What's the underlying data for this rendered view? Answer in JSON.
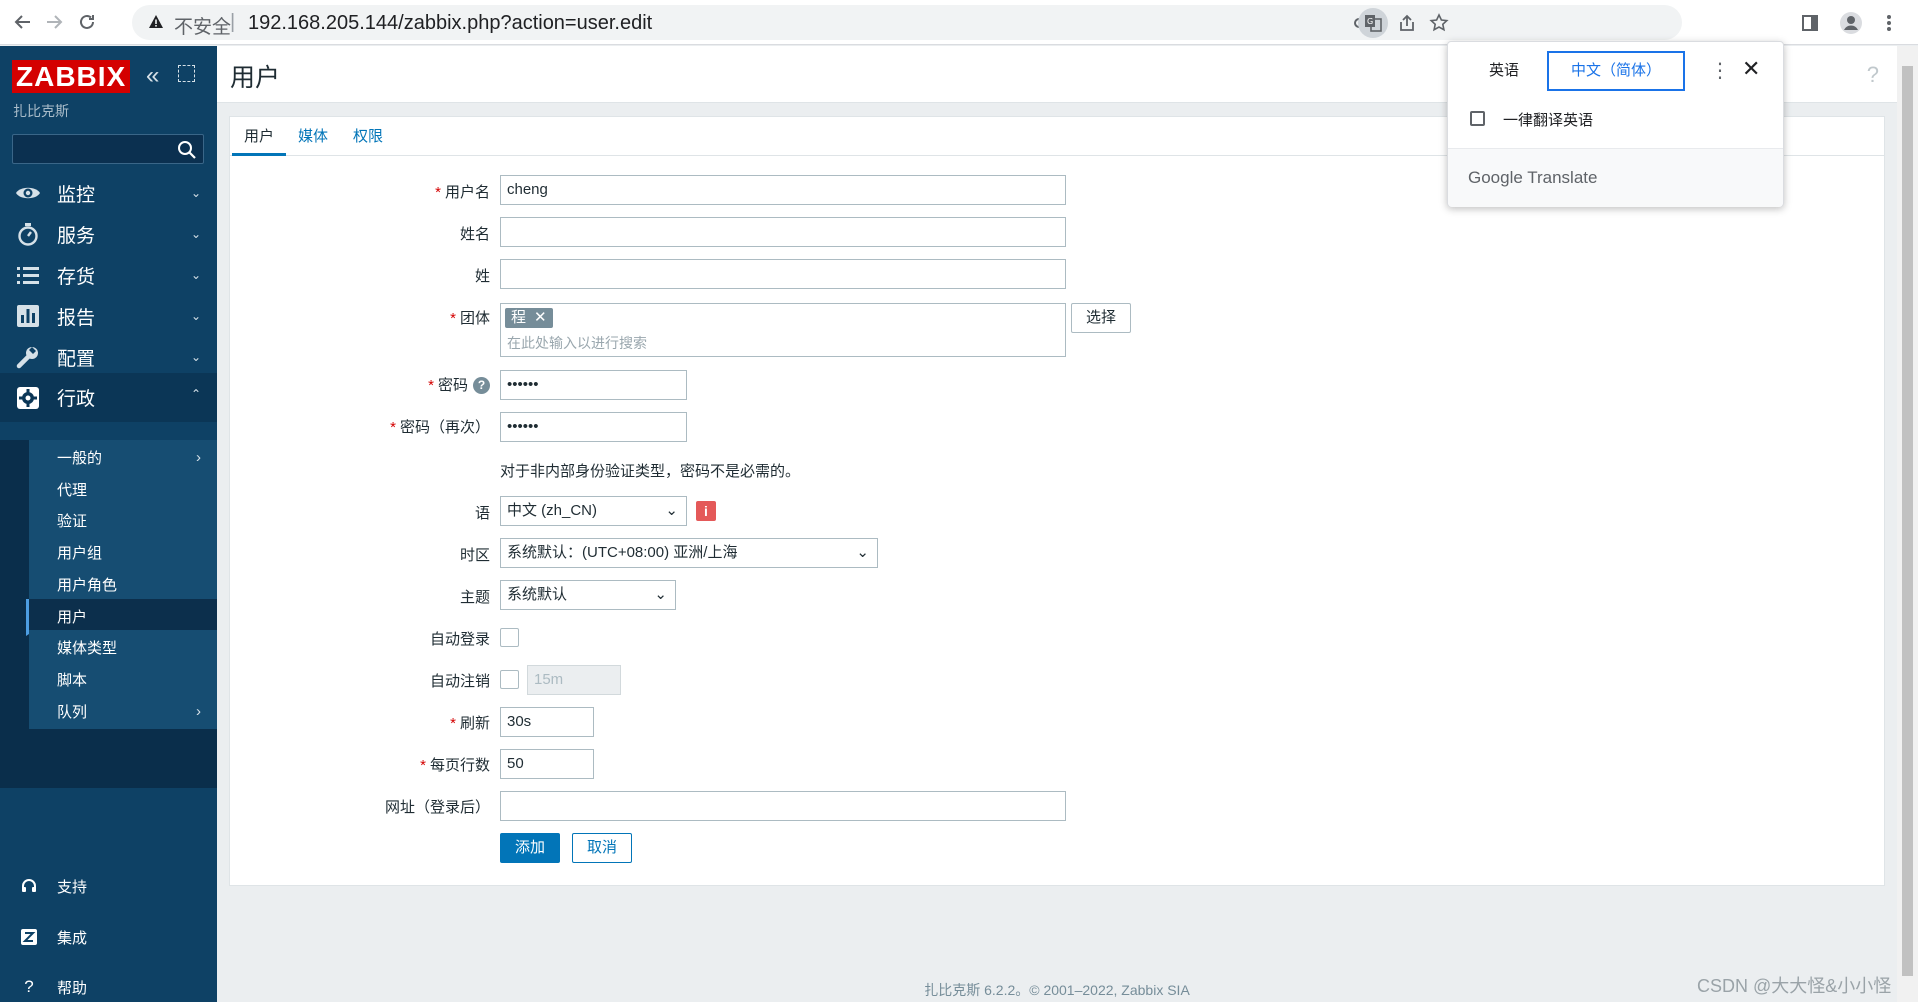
{
  "browser": {
    "security_label": "不安全",
    "url": "192.168.205.144/zabbix.php?action=user.edit"
  },
  "sidebar": {
    "logo": "ZABBIX",
    "server_name": "扎比克斯",
    "search_placeholder": "",
    "menu": [
      {
        "label": "监控"
      },
      {
        "label": "服务"
      },
      {
        "label": "存货"
      },
      {
        "label": "报告"
      },
      {
        "label": "配置"
      },
      {
        "label": "行政"
      }
    ],
    "submenu": [
      {
        "label": "一般的"
      },
      {
        "label": "代理"
      },
      {
        "label": "验证"
      },
      {
        "label": "用户组"
      },
      {
        "label": "用户角色"
      },
      {
        "label": "用户"
      },
      {
        "label": "媒体类型"
      },
      {
        "label": "脚本"
      },
      {
        "label": "队列"
      }
    ],
    "bottom": [
      {
        "label": "支持"
      },
      {
        "label": "集成"
      },
      {
        "label": "帮助"
      }
    ]
  },
  "page": {
    "title": "用户",
    "help": "?"
  },
  "tabs": [
    {
      "label": "用户"
    },
    {
      "label": "媒体"
    },
    {
      "label": "权限"
    }
  ],
  "form": {
    "username": {
      "label": "用户名",
      "value": "cheng"
    },
    "name": {
      "label": "姓名",
      "value": ""
    },
    "surname": {
      "label": "姓",
      "value": ""
    },
    "groups": {
      "label": "团体",
      "chip": "程",
      "chip_remove": "✕",
      "placeholder": "在此处输入以进行搜索",
      "select_button": "选择"
    },
    "password": {
      "label": "密码",
      "value": "••••••",
      "help": "?"
    },
    "password_again": {
      "label": "密码（再次）",
      "value": "••••••"
    },
    "password_hint": "对于非内部身份验证类型，密码不是必需的。",
    "language": {
      "label": "语",
      "value": "中文 (zh_CN)",
      "info": "i"
    },
    "timezone": {
      "label": "时区",
      "value": "系统默认：(UTC+08:00) 亚洲/上海"
    },
    "theme": {
      "label": "主题",
      "value": "系统默认"
    },
    "autologin": {
      "label": "自动登录"
    },
    "autologout": {
      "label": "自动注销",
      "value": "15m"
    },
    "refresh": {
      "label": "刷新",
      "value": "30s"
    },
    "rows_per_page": {
      "label": "每页行数",
      "value": "50"
    },
    "url": {
      "label": "网址（登录后）",
      "value": ""
    },
    "add_button": "添加",
    "cancel_button": "取消"
  },
  "footer": "扎比克斯 6.2.2。© 2001–2022, Zabbix SIA",
  "watermark": "CSDN @大大怪&小小怪",
  "translate_popup": {
    "lang_source": "英语",
    "lang_target": "中文（简体）",
    "always_translate": "一律翻译英语",
    "brand": "Google Translate"
  },
  "colors": {
    "sidebar_bg": "#0e4165",
    "accent": "#0275b8",
    "required": "#d40000",
    "logo_bg": "#d40000"
  }
}
